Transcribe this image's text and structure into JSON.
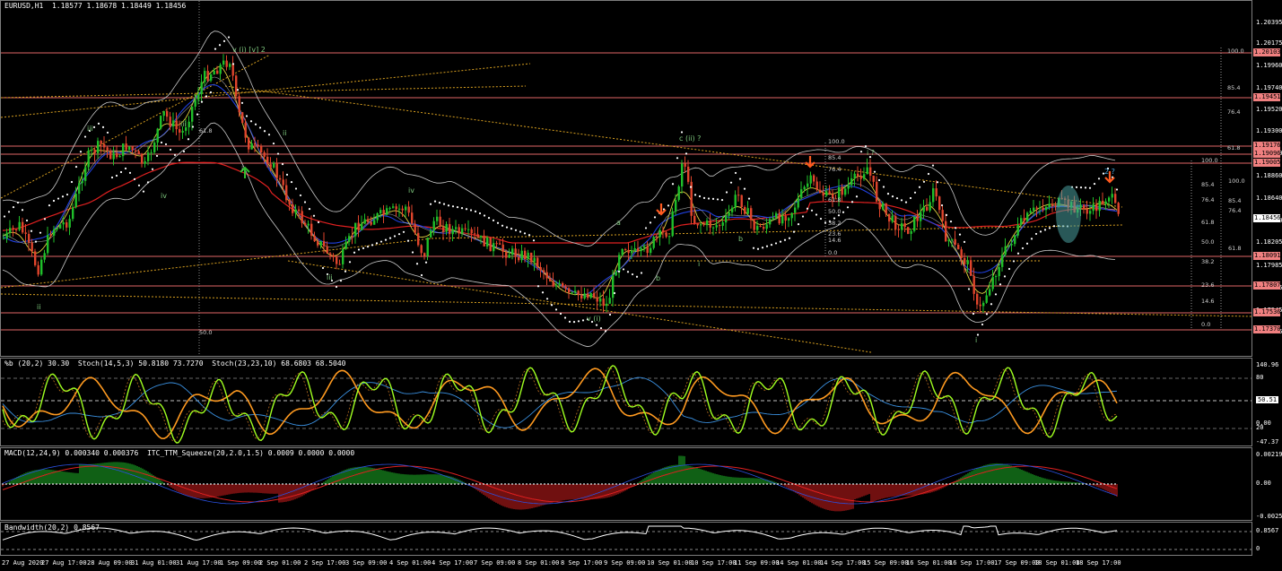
{
  "window": {
    "symbol_title": "EURUSD,H1  1.18577 1.18678 1.18449 1.18456"
  },
  "colors": {
    "background": "#000000",
    "bull_candle": "#1fbf2a",
    "bear_candle": "#e0452c",
    "level_line": "#e06666",
    "ema_red": "#e02020",
    "ema_blue": "#2040e0",
    "ema_yellow": "#e0d040",
    "bollinger": "#c8c8c8",
    "psar": "#ffffff",
    "fib_dotted": "#d8a020",
    "price_tag": "#f08080",
    "current_tag": "#ffffff",
    "arrow": "#ff5a1f",
    "wave_label": "#7ec87e",
    "macd_up": "#1fbf2a",
    "macd_down": "#e02020",
    "stoch_green": "#a0ff20",
    "stoch_orange": "#ff9a20",
    "stoch_blue": "#3a90e0"
  },
  "main_chart": {
    "price_axis": [
      "1.20395",
      "1.20175",
      "1.19960",
      "1.19740",
      "1.19520",
      "1.19300",
      "1.19080",
      "1.18860",
      "1.18640",
      "1.18420",
      "1.18205",
      "1.17985",
      "1.17765",
      "1.17545",
      "1.17325"
    ],
    "level_tags": [
      {
        "label": "1.20103",
        "kind": "level"
      },
      {
        "label": "1.19451",
        "kind": "level"
      },
      {
        "label": "1.19176",
        "kind": "level"
      },
      {
        "label": "1.19096",
        "kind": "level"
      },
      {
        "label": "1.19005",
        "kind": "level"
      },
      {
        "label": "1.18456",
        "kind": "current"
      },
      {
        "label": "1.18091",
        "kind": "level"
      },
      {
        "label": "1.17807",
        "kind": "level"
      },
      {
        "label": "1.17536",
        "kind": "level"
      },
      {
        "label": "1.17370",
        "kind": "level"
      }
    ],
    "fib_labels_left": [
      "100.0",
      "85.4",
      "76.4",
      "61.8",
      "50.0",
      "38.2",
      "23.6",
      "14.6",
      "0.0"
    ],
    "fib_labels_mid": [
      "100.0",
      "85.4",
      "76.4",
      "61.8",
      "50.0",
      "38.2",
      "23.6",
      "14.6",
      "0.0"
    ],
    "fib_labels_right": [
      "100.0",
      "85.4",
      "76.4",
      "61.8",
      "50.0",
      "38.2",
      "23.6",
      "14.6",
      "0.0"
    ],
    "fib_labels_top": [
      "100.0",
      "85.4",
      "76.4",
      "61.8"
    ],
    "fib_extra": [
      "61.8",
      "50.0"
    ],
    "wave_labels": [
      "v (i) [v] 2",
      "iii",
      "ii",
      "i",
      "iv",
      "iii",
      "ii",
      "iv",
      "iii",
      "c (ii) ?",
      "a",
      "b",
      "v (i)",
      "i",
      "i ?",
      "2 ?",
      "i",
      "b"
    ]
  },
  "stoch_pane": {
    "label": "%b (20,2) 30.30  Stoch(14,5,3) 50.8180 73.7270  Stoch(23,23,10) 68.6803 68.5040",
    "axis": [
      "140.96",
      "80",
      "50.51",
      "0.00",
      "20",
      "-47.37"
    ]
  },
  "macd_pane": {
    "label": "MACD(12,24,9) 0.000340 0.000376  ITC_TTM_Squeeze(20,2.0,1.5) 0.0009 0.0000 0.0000",
    "axis": [
      "0.002190",
      "0.00",
      "-0.002504"
    ]
  },
  "bw_pane": {
    "label": "Bandwidth(20,2) 0.8567",
    "axis": [
      "0.8567",
      "0"
    ]
  },
  "time_axis": [
    "27 Aug 2020",
    "27 Aug 17:00",
    "28 Aug 09:00",
    "31 Aug 01:00",
    "31 Aug 17:00",
    "1 Sep 09:00",
    "2 Sep 01:00",
    "2 Sep 17:00",
    "3 Sep 09:00",
    "4 Sep 01:00",
    "4 Sep 17:00",
    "7 Sep 09:00",
    "8 Sep 01:00",
    "8 Sep 17:00",
    "9 Sep 09:00",
    "10 Sep 01:00",
    "10 Sep 17:00",
    "11 Sep 09:00",
    "14 Sep 01:00",
    "14 Sep 17:00",
    "15 Sep 09:00",
    "16 Sep 01:00",
    "16 Sep 17:00",
    "17 Sep 09:00",
    "18 Sep 01:00",
    "18 Sep 17:00"
  ]
}
